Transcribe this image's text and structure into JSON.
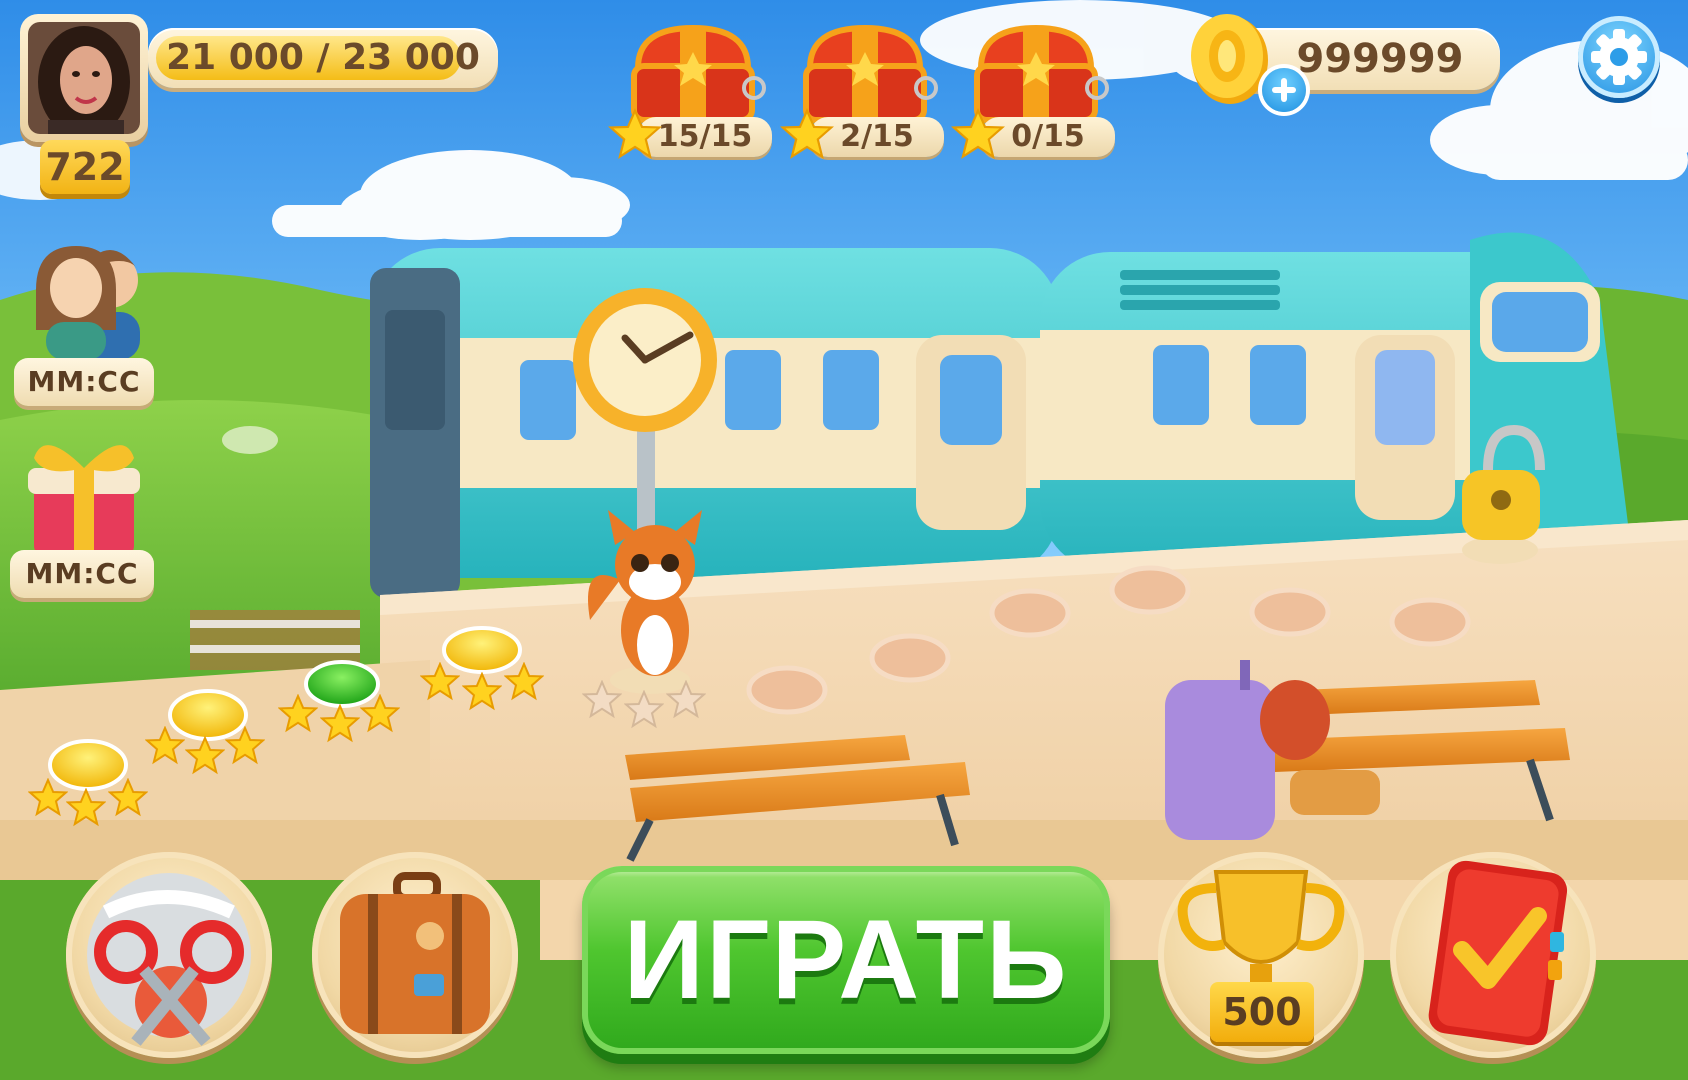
{
  "player": {
    "xp_progress": "21 000 / 23 000",
    "xp_current": 21000,
    "xp_max": 23000,
    "level": "722"
  },
  "chests": [
    {
      "count": "15/15",
      "progress": 1.0
    },
    {
      "count": "2/15",
      "progress": 0.133
    },
    {
      "count": "0/15",
      "progress": 0.0
    }
  ],
  "currency": {
    "coins": "999999",
    "icon": "gold-coin-icon",
    "add_icon": "plus-icon"
  },
  "settings": {
    "icon": "gear-icon"
  },
  "side_events": [
    {
      "icon": "friends-icon",
      "timer": "ММ:СС"
    },
    {
      "icon": "gift-box-icon",
      "timer": "ММ:СС"
    }
  ],
  "bottom_bar": {
    "play_label": "ИГРАТЬ",
    "trophy_score": "500",
    "buttons": [
      "sewing-kit-icon",
      "suitcase-icon",
      "trophy-icon",
      "task-book-icon"
    ]
  },
  "colors": {
    "sky": "#3d9ef0",
    "play_green": "#4fc62f",
    "train_teal": "#3cc8cc",
    "platform": "#f4d9b4"
  },
  "level_map": {
    "completed_levels": 5,
    "current_level": 6,
    "stars_per_level": 3
  }
}
